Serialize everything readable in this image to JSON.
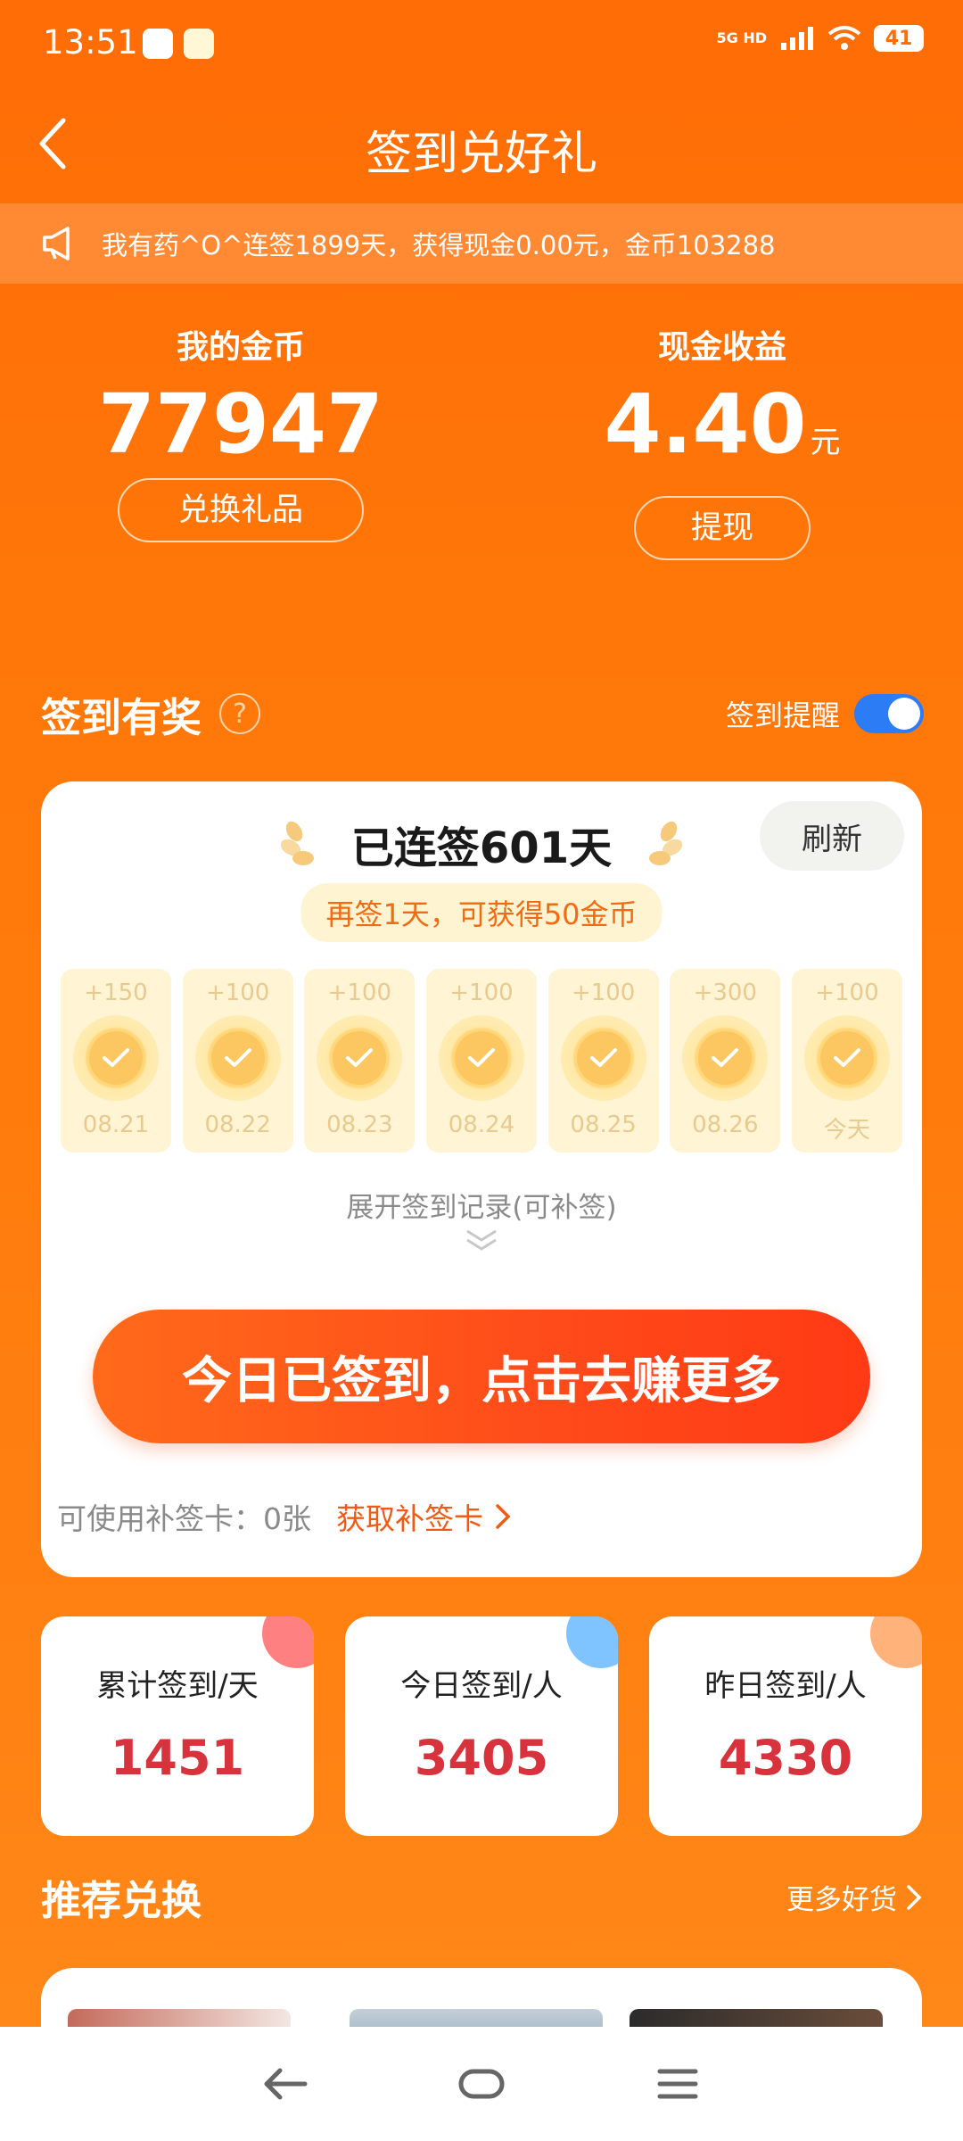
{
  "status": {
    "time": "13:51",
    "network": "5G HD",
    "battery": "41"
  },
  "header": {
    "title": "签到兑好礼"
  },
  "notice": {
    "text": "我有药^O^连签1899天，获得现金0.00元，金币103288"
  },
  "earnings": {
    "coins_label": "我的金币",
    "coins_value": "77947",
    "coins_button": "兑换礼品",
    "cash_label": "现金收益",
    "cash_value": "4.40",
    "cash_unit": "元",
    "cash_button": "提现"
  },
  "checkin_section": {
    "title": "签到有奖",
    "help": "?",
    "reminder_label": "签到提醒",
    "reminder_on": true
  },
  "card": {
    "streak_text": "已连签601天",
    "refresh": "刷新",
    "hint": "再签1天，可获得50金币",
    "days": [
      {
        "reward": "+150",
        "date": "08.21"
      },
      {
        "reward": "+100",
        "date": "08.22"
      },
      {
        "reward": "+100",
        "date": "08.23"
      },
      {
        "reward": "+100",
        "date": "08.24"
      },
      {
        "reward": "+100",
        "date": "08.25"
      },
      {
        "reward": "+300",
        "date": "08.26"
      },
      {
        "reward": "+100",
        "date": "今天"
      }
    ],
    "expand_text": "展开签到记录(可补签)",
    "main_button": "今日已签到，点击去赚更多",
    "makeup_label": "可使用补签卡：0张",
    "makeup_link": "获取补签卡"
  },
  "stats": [
    {
      "label": "累计签到/天",
      "value": "1451",
      "color": "#ff8080"
    },
    {
      "label": "今日签到/人",
      "value": "3405",
      "color": "#7fc3ff"
    },
    {
      "label": "昨日签到/人",
      "value": "4330",
      "color": "#ffb27a"
    }
  ],
  "recommend": {
    "title": "推荐兑换",
    "more": "更多好货"
  },
  "colors": {
    "background": "#ff7a0a",
    "primary_button": "#ff4a1a",
    "stat_value": "#d8323c",
    "toggle": "#2c7cf6"
  }
}
